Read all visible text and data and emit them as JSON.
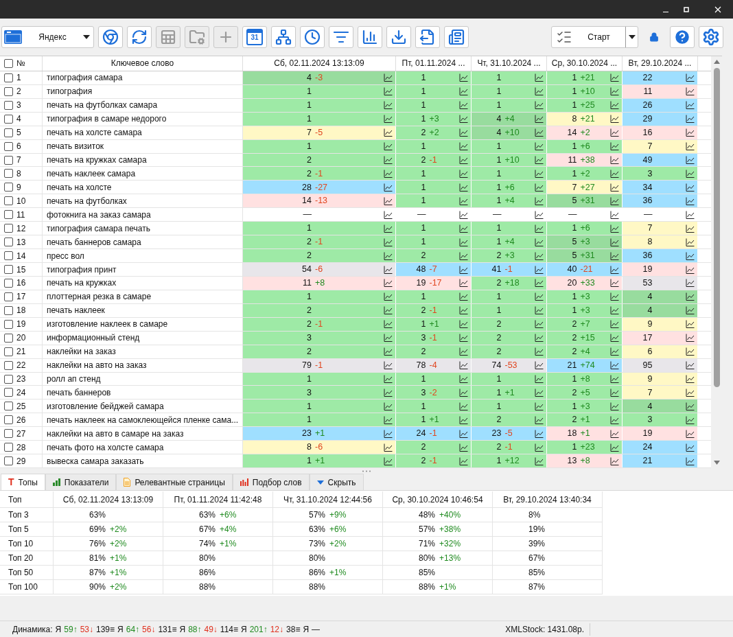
{
  "toolbar": {
    "engine": {
      "label": "Яндекс"
    },
    "buttons": [
      {
        "disabled": false
      },
      {
        "disabled": false
      },
      {
        "disabled": true
      },
      {
        "disabled": true
      },
      {
        "disabled": true
      },
      {
        "disabled": false,
        "label": "31"
      },
      {
        "disabled": false
      },
      {
        "disabled": false
      },
      {
        "disabled": false
      },
      {
        "disabled": false
      },
      {
        "disabled": false
      },
      {
        "disabled": false
      },
      {
        "disabled": false
      }
    ],
    "start": {
      "label": "Старт"
    }
  },
  "table": {
    "number_header": "№",
    "keyword_header": "Ключевое слово",
    "date_columns": [
      "Сб, 02.11.2024 13:13:09",
      "Пт, 01.11.2024 ...",
      "Чт, 31.10.2024 ...",
      "Ср, 30.10.2024 ...",
      "Вт, 29.10.2024 ..."
    ],
    "header_checked": false,
    "rows": [
      {
        "n": "1",
        "keyword": "типография самара",
        "checked": false,
        "cells": [
          {
            "value": "4",
            "delta": "-3",
            "negative": true,
            "color": "#98dc9e"
          },
          {
            "value": "1",
            "color": "#9eeaa6"
          },
          {
            "value": "1",
            "color": "#9eeaa6"
          },
          {
            "value": "1",
            "delta": "+21",
            "negative": false,
            "color": "#9eeaa6"
          },
          {
            "value": "22",
            "color": "#9fdfff"
          }
        ]
      },
      {
        "n": "2",
        "keyword": "типография",
        "checked": false,
        "cells": [
          {
            "value": "1",
            "color": "#9eeaa6"
          },
          {
            "value": "1",
            "color": "#9eeaa6"
          },
          {
            "value": "1",
            "color": "#9eeaa6"
          },
          {
            "value": "1",
            "delta": "+10",
            "negative": false,
            "color": "#9eeaa6"
          },
          {
            "value": "11",
            "color": "#ffe1e1"
          }
        ]
      },
      {
        "n": "3",
        "keyword": "печать на футболках самара",
        "checked": false,
        "cells": [
          {
            "value": "1",
            "color": "#9eeaa6"
          },
          {
            "value": "1",
            "color": "#9eeaa6"
          },
          {
            "value": "1",
            "color": "#9eeaa6"
          },
          {
            "value": "1",
            "delta": "+25",
            "negative": false,
            "color": "#9eeaa6"
          },
          {
            "value": "26",
            "color": "#9fdfff"
          }
        ]
      },
      {
        "n": "4",
        "keyword": "типография в самаре недорого",
        "checked": false,
        "cells": [
          {
            "value": "1",
            "color": "#9eeaa6"
          },
          {
            "value": "1",
            "delta": "+3",
            "negative": false,
            "color": "#9eeaa6"
          },
          {
            "value": "4",
            "delta": "+4",
            "negative": false,
            "color": "#98dc9e"
          },
          {
            "value": "8",
            "delta": "+21",
            "negative": false,
            "color": "#fff8c5"
          },
          {
            "value": "29",
            "color": "#9fdfff"
          }
        ]
      },
      {
        "n": "5",
        "keyword": "печать на холсте самара",
        "checked": false,
        "cells": [
          {
            "value": "7",
            "delta": "-5",
            "negative": true,
            "color": "#fff8c5"
          },
          {
            "value": "2",
            "delta": "+2",
            "negative": false,
            "color": "#9eeaa6"
          },
          {
            "value": "4",
            "delta": "+10",
            "negative": false,
            "color": "#98dc9e"
          },
          {
            "value": "14",
            "delta": "+2",
            "negative": false,
            "color": "#ffe1e1"
          },
          {
            "value": "16",
            "color": "#ffe1e1"
          }
        ]
      },
      {
        "n": "6",
        "keyword": "печать визиток",
        "checked": false,
        "cells": [
          {
            "value": "1",
            "color": "#9eeaa6"
          },
          {
            "value": "1",
            "color": "#9eeaa6"
          },
          {
            "value": "1",
            "color": "#9eeaa6"
          },
          {
            "value": "1",
            "delta": "+6",
            "negative": false,
            "color": "#9eeaa6"
          },
          {
            "value": "7",
            "color": "#fff8c5"
          }
        ]
      },
      {
        "n": "7",
        "keyword": "печать на кружках самара",
        "checked": false,
        "cells": [
          {
            "value": "2",
            "color": "#9eeaa6"
          },
          {
            "value": "2",
            "delta": "-1",
            "negative": true,
            "color": "#9eeaa6"
          },
          {
            "value": "1",
            "delta": "+10",
            "negative": false,
            "color": "#9eeaa6"
          },
          {
            "value": "11",
            "delta": "+38",
            "negative": false,
            "color": "#ffe1e1"
          },
          {
            "value": "49",
            "color": "#9fdfff"
          }
        ]
      },
      {
        "n": "8",
        "keyword": "печать наклеек самара",
        "checked": false,
        "cells": [
          {
            "value": "2",
            "delta": "-1",
            "negative": true,
            "color": "#9eeaa6"
          },
          {
            "value": "1",
            "color": "#9eeaa6"
          },
          {
            "value": "1",
            "color": "#9eeaa6"
          },
          {
            "value": "1",
            "delta": "+2",
            "negative": false,
            "color": "#9eeaa6"
          },
          {
            "value": "3",
            "color": "#9eeaa6"
          }
        ]
      },
      {
        "n": "9",
        "keyword": "печать на холсте",
        "checked": false,
        "cells": [
          {
            "value": "28",
            "delta": "-27",
            "negative": true,
            "color": "#9fdfff"
          },
          {
            "value": "1",
            "color": "#9eeaa6"
          },
          {
            "value": "1",
            "delta": "+6",
            "negative": false,
            "color": "#9eeaa6"
          },
          {
            "value": "7",
            "delta": "+27",
            "negative": false,
            "color": "#fff8c5"
          },
          {
            "value": "34",
            "color": "#9fdfff"
          }
        ]
      },
      {
        "n": "10",
        "keyword": "печать на футболках",
        "checked": false,
        "cells": [
          {
            "value": "14",
            "delta": "-13",
            "negative": true,
            "color": "#ffe1e1"
          },
          {
            "value": "1",
            "color": "#9eeaa6"
          },
          {
            "value": "1",
            "delta": "+4",
            "negative": false,
            "color": "#9eeaa6"
          },
          {
            "value": "5",
            "delta": "+31",
            "negative": false,
            "color": "#98dc9e"
          },
          {
            "value": "36",
            "color": "#9fdfff"
          }
        ]
      },
      {
        "n": "11",
        "keyword": "фотокнига на заказ самара",
        "checked": false,
        "cells": [
          {
            "value": "—",
            "color": "#ffffff"
          },
          {
            "value": "—",
            "color": "#ffffff"
          },
          {
            "value": "—",
            "color": "#ffffff"
          },
          {
            "value": "—",
            "color": "#ffffff"
          },
          {
            "value": "—",
            "color": "#ffffff"
          }
        ]
      },
      {
        "n": "12",
        "keyword": "типография самара печать",
        "checked": false,
        "cells": [
          {
            "value": "1",
            "color": "#9eeaa6"
          },
          {
            "value": "1",
            "color": "#9eeaa6"
          },
          {
            "value": "1",
            "color": "#9eeaa6"
          },
          {
            "value": "1",
            "delta": "+6",
            "negative": false,
            "color": "#9eeaa6"
          },
          {
            "value": "7",
            "color": "#fff8c5"
          }
        ]
      },
      {
        "n": "13",
        "keyword": "печать баннеров самара",
        "checked": false,
        "cells": [
          {
            "value": "2",
            "delta": "-1",
            "negative": true,
            "color": "#9eeaa6"
          },
          {
            "value": "1",
            "color": "#9eeaa6"
          },
          {
            "value": "1",
            "delta": "+4",
            "negative": false,
            "color": "#9eeaa6"
          },
          {
            "value": "5",
            "delta": "+3",
            "negative": false,
            "color": "#98dc9e"
          },
          {
            "value": "8",
            "color": "#fff8c5"
          }
        ]
      },
      {
        "n": "14",
        "keyword": "пресс вол",
        "checked": false,
        "cells": [
          {
            "value": "2",
            "color": "#9eeaa6"
          },
          {
            "value": "2",
            "color": "#9eeaa6"
          },
          {
            "value": "2",
            "delta": "+3",
            "negative": false,
            "color": "#9eeaa6"
          },
          {
            "value": "5",
            "delta": "+31",
            "negative": false,
            "color": "#98dc9e"
          },
          {
            "value": "36",
            "color": "#9fdfff"
          }
        ]
      },
      {
        "n": "15",
        "keyword": "типография принт",
        "checked": false,
        "cells": [
          {
            "value": "54",
            "delta": "-6",
            "negative": true,
            "color": "#e8e6ea"
          },
          {
            "value": "48",
            "delta": "-7",
            "negative": true,
            "color": "#9fdfff"
          },
          {
            "value": "41",
            "delta": "-1",
            "negative": true,
            "color": "#9fdfff"
          },
          {
            "value": "40",
            "delta": "-21",
            "negative": true,
            "color": "#9fdfff"
          },
          {
            "value": "19",
            "color": "#ffe1e1"
          }
        ]
      },
      {
        "n": "16",
        "keyword": "печать на кружках",
        "checked": false,
        "cells": [
          {
            "value": "11",
            "delta": "+8",
            "negative": false,
            "color": "#ffe1e1"
          },
          {
            "value": "19",
            "delta": "-17",
            "negative": true,
            "color": "#ffe1e1"
          },
          {
            "value": "2",
            "delta": "+18",
            "negative": false,
            "color": "#9eeaa6"
          },
          {
            "value": "20",
            "delta": "+33",
            "negative": false,
            "color": "#ffe1e1"
          },
          {
            "value": "53",
            "color": "#e8e6ea"
          }
        ]
      },
      {
        "n": "17",
        "keyword": "плоттерная резка в самаре",
        "checked": false,
        "cells": [
          {
            "value": "1",
            "color": "#9eeaa6"
          },
          {
            "value": "1",
            "color": "#9eeaa6"
          },
          {
            "value": "1",
            "color": "#9eeaa6"
          },
          {
            "value": "1",
            "delta": "+3",
            "negative": false,
            "color": "#9eeaa6"
          },
          {
            "value": "4",
            "color": "#98dc9e"
          }
        ]
      },
      {
        "n": "18",
        "keyword": "печать наклеек",
        "checked": false,
        "cells": [
          {
            "value": "2",
            "color": "#9eeaa6"
          },
          {
            "value": "2",
            "delta": "-1",
            "negative": true,
            "color": "#9eeaa6"
          },
          {
            "value": "1",
            "color": "#9eeaa6"
          },
          {
            "value": "1",
            "delta": "+3",
            "negative": false,
            "color": "#9eeaa6"
          },
          {
            "value": "4",
            "color": "#98dc9e"
          }
        ]
      },
      {
        "n": "19",
        "keyword": "изготовление наклеек в самаре",
        "checked": false,
        "cells": [
          {
            "value": "2",
            "delta": "-1",
            "negative": true,
            "color": "#9eeaa6"
          },
          {
            "value": "1",
            "delta": "+1",
            "negative": false,
            "color": "#9eeaa6"
          },
          {
            "value": "2",
            "color": "#9eeaa6"
          },
          {
            "value": "2",
            "delta": "+7",
            "negative": false,
            "color": "#9eeaa6"
          },
          {
            "value": "9",
            "color": "#fff8c5"
          }
        ]
      },
      {
        "n": "20",
        "keyword": "информационный стенд",
        "checked": false,
        "cells": [
          {
            "value": "3",
            "color": "#9eeaa6"
          },
          {
            "value": "3",
            "delta": "-1",
            "negative": true,
            "color": "#9eeaa6"
          },
          {
            "value": "2",
            "color": "#9eeaa6"
          },
          {
            "value": "2",
            "delta": "+15",
            "negative": false,
            "color": "#9eeaa6"
          },
          {
            "value": "17",
            "color": "#ffe1e1"
          }
        ]
      },
      {
        "n": "21",
        "keyword": "наклейки на заказ",
        "checked": false,
        "cells": [
          {
            "value": "2",
            "color": "#9eeaa6"
          },
          {
            "value": "2",
            "color": "#9eeaa6"
          },
          {
            "value": "2",
            "color": "#9eeaa6"
          },
          {
            "value": "2",
            "delta": "+4",
            "negative": false,
            "color": "#9eeaa6"
          },
          {
            "value": "6",
            "color": "#fff8c5"
          }
        ]
      },
      {
        "n": "22",
        "keyword": "наклейки на авто на заказ",
        "checked": false,
        "cells": [
          {
            "value": "79",
            "delta": "-1",
            "negative": true,
            "color": "#e8e6ea"
          },
          {
            "value": "78",
            "delta": "-4",
            "negative": true,
            "color": "#e8e6ea"
          },
          {
            "value": "74",
            "delta": "-53",
            "negative": true,
            "color": "#e8e6ea"
          },
          {
            "value": "21",
            "delta": "+74",
            "negative": false,
            "color": "#9fdfff"
          },
          {
            "value": "95",
            "color": "#e8e6ea"
          }
        ]
      },
      {
        "n": "23",
        "keyword": "ролл ап стенд",
        "checked": false,
        "cells": [
          {
            "value": "1",
            "color": "#9eeaa6"
          },
          {
            "value": "1",
            "color": "#9eeaa6"
          },
          {
            "value": "1",
            "color": "#9eeaa6"
          },
          {
            "value": "1",
            "delta": "+8",
            "negative": false,
            "color": "#9eeaa6"
          },
          {
            "value": "9",
            "color": "#fff8c5"
          }
        ]
      },
      {
        "n": "24",
        "keyword": "печать баннеров",
        "checked": false,
        "cells": [
          {
            "value": "3",
            "color": "#9eeaa6"
          },
          {
            "value": "3",
            "delta": "-2",
            "negative": true,
            "color": "#9eeaa6"
          },
          {
            "value": "1",
            "delta": "+1",
            "negative": false,
            "color": "#9eeaa6"
          },
          {
            "value": "2",
            "delta": "+5",
            "negative": false,
            "color": "#9eeaa6"
          },
          {
            "value": "7",
            "color": "#fff8c5"
          }
        ]
      },
      {
        "n": "25",
        "keyword": "изготовление бейджей самара",
        "checked": false,
        "cells": [
          {
            "value": "1",
            "color": "#9eeaa6"
          },
          {
            "value": "1",
            "color": "#9eeaa6"
          },
          {
            "value": "1",
            "color": "#9eeaa6"
          },
          {
            "value": "1",
            "delta": "+3",
            "negative": false,
            "color": "#9eeaa6"
          },
          {
            "value": "4",
            "color": "#98dc9e"
          }
        ]
      },
      {
        "n": "26",
        "keyword": "печать наклеек на самоклеющейся пленке сама...",
        "checked": false,
        "cells": [
          {
            "value": "1",
            "color": "#9eeaa6"
          },
          {
            "value": "1",
            "delta": "+1",
            "negative": false,
            "color": "#9eeaa6"
          },
          {
            "value": "2",
            "color": "#9eeaa6"
          },
          {
            "value": "2",
            "delta": "+1",
            "negative": false,
            "color": "#9eeaa6"
          },
          {
            "value": "3",
            "color": "#9eeaa6"
          }
        ]
      },
      {
        "n": "27",
        "keyword": "наклейки на авто в самаре на заказ",
        "checked": false,
        "cells": [
          {
            "value": "23",
            "delta": "+1",
            "negative": false,
            "color": "#9fdfff"
          },
          {
            "value": "24",
            "delta": "-1",
            "negative": true,
            "color": "#9fdfff"
          },
          {
            "value": "23",
            "delta": "-5",
            "negative": true,
            "color": "#9fdfff"
          },
          {
            "value": "18",
            "delta": "+1",
            "negative": false,
            "color": "#ffe1e1"
          },
          {
            "value": "19",
            "color": "#ffe1e1"
          }
        ]
      },
      {
        "n": "28",
        "keyword": "печать фото на холсте самара",
        "checked": false,
        "cells": [
          {
            "value": "8",
            "delta": "-6",
            "negative": true,
            "color": "#fff8c5"
          },
          {
            "value": "2",
            "color": "#9eeaa6"
          },
          {
            "value": "2",
            "delta": "-1",
            "negative": true,
            "color": "#9eeaa6"
          },
          {
            "value": "1",
            "delta": "+23",
            "negative": false,
            "color": "#9eeaa6"
          },
          {
            "value": "24",
            "color": "#9fdfff"
          }
        ]
      },
      {
        "n": "29",
        "keyword": "вывеска самара заказать",
        "checked": false,
        "cells": [
          {
            "value": "1",
            "delta": "+1",
            "negative": false,
            "color": "#9eeaa6"
          },
          {
            "value": "2",
            "delta": "-1",
            "negative": true,
            "color": "#9eeaa6"
          },
          {
            "value": "1",
            "delta": "+12",
            "negative": false,
            "color": "#9eeaa6"
          },
          {
            "value": "13",
            "delta": "+8",
            "negative": false,
            "color": "#ffe1e1"
          },
          {
            "value": "21",
            "color": "#9fdfff"
          }
        ]
      }
    ]
  },
  "bottom_tabs": [
    {
      "label": "Топы",
      "mark": "T",
      "selected": true,
      "kind": "tops"
    },
    {
      "label": "Показатели",
      "selected": false,
      "kind": "metrics"
    },
    {
      "label": "Релевантные страницы",
      "selected": false,
      "kind": "pages"
    },
    {
      "label": "Подбор слов",
      "selected": false,
      "kind": "words"
    },
    {
      "label": "Скрыть",
      "selected": false,
      "kind": "hide"
    }
  ],
  "tops": {
    "label_header": "Топ",
    "date_columns": [
      "Сб, 02.11.2024 13:13:09",
      "Пт, 01.11.2024 11:42:48",
      "Чт, 31.10.2024 12:44:56",
      "Ср, 30.10.2024 10:46:54",
      "Вт, 29.10.2024 13:40:34"
    ],
    "rows": [
      {
        "label": "Топ 3",
        "cells": [
          {
            "value": "63%"
          },
          {
            "value": "63%",
            "delta": "+6%"
          },
          {
            "value": "57%",
            "delta": "+9%"
          },
          {
            "value": "48%",
            "delta": "+40%"
          },
          {
            "value": "8%"
          }
        ]
      },
      {
        "label": "Топ 5",
        "cells": [
          {
            "value": "69%",
            "delta": "+2%"
          },
          {
            "value": "67%",
            "delta": "+4%"
          },
          {
            "value": "63%",
            "delta": "+6%"
          },
          {
            "value": "57%",
            "delta": "+38%"
          },
          {
            "value": "19%"
          }
        ]
      },
      {
        "label": "Топ 10",
        "cells": [
          {
            "value": "76%",
            "delta": "+2%"
          },
          {
            "value": "74%",
            "delta": "+1%"
          },
          {
            "value": "73%",
            "delta": "+2%"
          },
          {
            "value": "71%",
            "delta": "+32%"
          },
          {
            "value": "39%"
          }
        ]
      },
      {
        "label": "Топ 20",
        "cells": [
          {
            "value": "81%",
            "delta": "+1%"
          },
          {
            "value": "80%"
          },
          {
            "value": "80%"
          },
          {
            "value": "80%",
            "delta": "+13%"
          },
          {
            "value": "67%"
          }
        ]
      },
      {
        "label": "Топ 50",
        "cells": [
          {
            "value": "87%",
            "delta": "+1%"
          },
          {
            "value": "86%"
          },
          {
            "value": "86%",
            "delta": "+1%"
          },
          {
            "value": "85%"
          },
          {
            "value": "85%"
          }
        ]
      },
      {
        "label": "Топ 100",
        "cells": [
          {
            "value": "90%",
            "delta": "+2%"
          },
          {
            "value": "88%"
          },
          {
            "value": "88%"
          },
          {
            "value": "88%",
            "delta": "+1%"
          },
          {
            "value": "87%"
          }
        ]
      }
    ]
  },
  "status_bar": {
    "label": "Динамика:",
    "groups": [
      {
        "engine": "Я",
        "up": "59↑",
        "down": "53↓",
        "flat": "139≡"
      },
      {
        "engine": "Я",
        "up": "64↑",
        "down": "56↓",
        "flat": "131≡"
      },
      {
        "engine": "Я",
        "up": "88↑",
        "down": "49↓",
        "flat": "114≡"
      },
      {
        "engine": "Я",
        "up": "201↑",
        "down": "12↓",
        "flat": "38≡"
      },
      {
        "engine": "Я",
        "flat": "—"
      }
    ],
    "balance": "XMLStock: 1431.08р."
  }
}
